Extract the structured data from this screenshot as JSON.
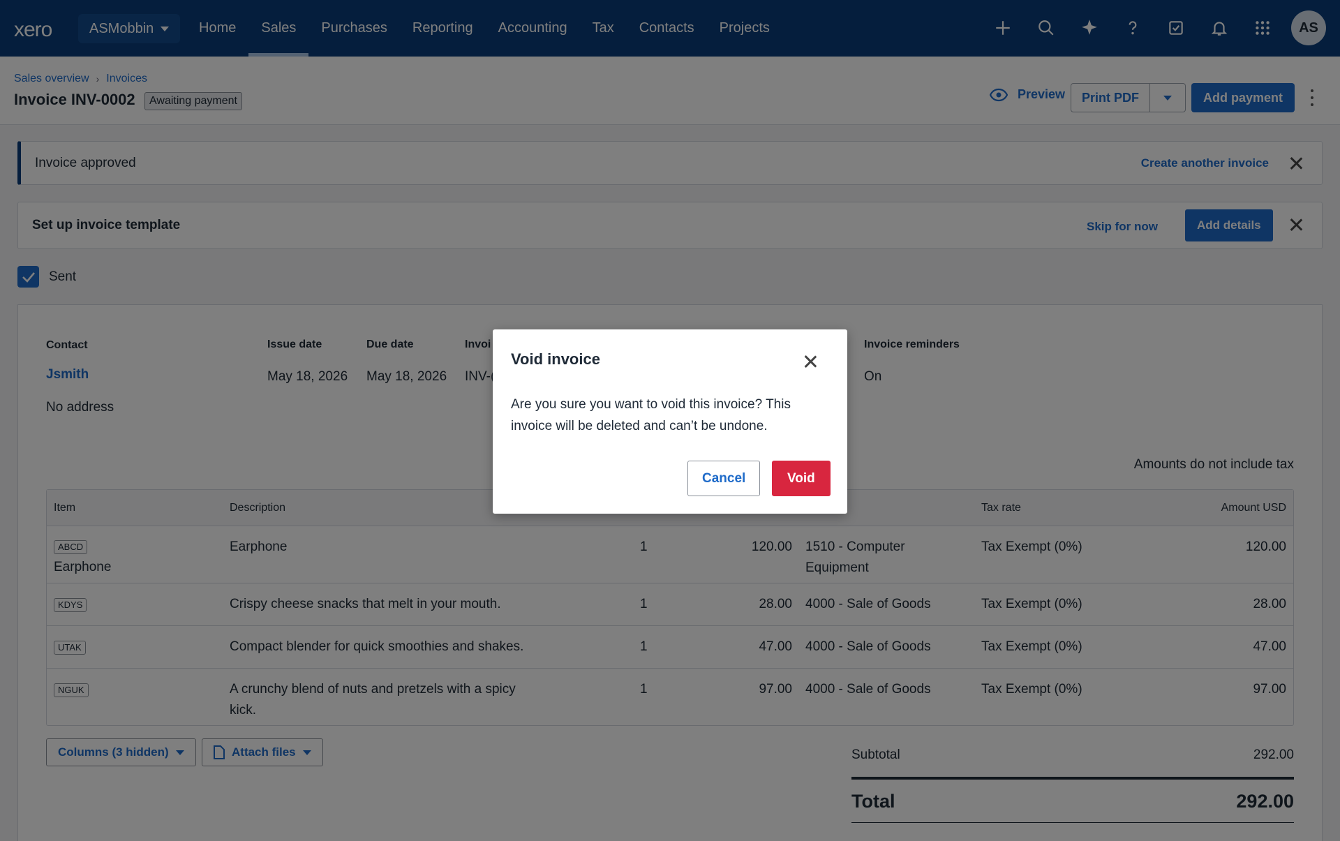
{
  "nav": {
    "logo": "xero",
    "org": "ASMobbin",
    "links": [
      "Home",
      "Sales",
      "Purchases",
      "Reporting",
      "Accounting",
      "Tax",
      "Contacts",
      "Projects"
    ],
    "active": "Sales",
    "icons": [
      "plus-icon",
      "search-icon",
      "sparkle-icon",
      "help-icon",
      "tasks-icon",
      "bell-icon",
      "apps-icon"
    ],
    "avatar": "AS"
  },
  "header": {
    "breadcrumbs": [
      "Sales overview",
      "Invoices"
    ],
    "title": "Invoice INV-0002",
    "status": "Awaiting payment",
    "preview": "Preview",
    "print_pdf": "Print PDF",
    "add_payment": "Add payment"
  },
  "banners": {
    "approved": "Invoice approved",
    "create_another": "Create another invoice",
    "template_title": "Set up invoice template",
    "skip": "Skip for now",
    "add_details": "Add details"
  },
  "sent": {
    "label": "Sent",
    "checked": true
  },
  "invoice": {
    "contact_label": "Contact",
    "contact": "Jsmith",
    "address": "No address",
    "issue_label": "Issue date",
    "issue": "May 18, 2026",
    "due_label": "Due date",
    "due": "May 18, 2026",
    "number_label": "Invoi",
    "number": "INV-(",
    "reminders_label": "Invoice reminders",
    "reminders": "On",
    "tax_note": "Amounts do not include tax",
    "columns": {
      "item": "Item",
      "description": "Description",
      "tax_rate": "Tax rate",
      "amount": "Amount USD"
    },
    "rows": [
      {
        "code": "ABCD",
        "item": "Earphone",
        "description": "Earphone",
        "qty": "1",
        "price": "120.00",
        "account_line1": "1510 - Computer",
        "account_line2": "Equipment",
        "tax": "Tax Exempt (0%)",
        "amount": "120.00"
      },
      {
        "code": "KDYS",
        "item": "",
        "description": "Crispy cheese snacks that melt in your mouth.",
        "qty": "1",
        "price": "28.00",
        "account_line1": "4000 - Sale of Goods",
        "account_line2": "",
        "tax": "Tax Exempt (0%)",
        "amount": "28.00"
      },
      {
        "code": "UTAK",
        "item": "",
        "description": "Compact blender for quick smoothies and shakes.",
        "qty": "1",
        "price": "47.00",
        "account_line1": "4000 - Sale of Goods",
        "account_line2": "",
        "tax": "Tax Exempt (0%)",
        "amount": "47.00"
      },
      {
        "code": "NGUK",
        "item": "",
        "description": "A crunchy blend of nuts and pretzels with a spicy",
        "description2": "kick.",
        "qty": "1",
        "price": "97.00",
        "account_line1": "4000 - Sale of Goods",
        "account_line2": "",
        "tax": "Tax Exempt (0%)",
        "amount": "97.00"
      }
    ],
    "columns_button": "Columns (3 hidden)",
    "attach_button": "Attach files",
    "subtotal_label": "Subtotal",
    "subtotal": "292.00",
    "total_label": "Total",
    "total": "292.00"
  },
  "modal": {
    "title": "Void invoice",
    "body": "Are you sure you want to void this invoice? This invoice will be deleted and can’t be undone.",
    "cancel": "Cancel",
    "void": "Void"
  },
  "colors": {
    "nav_bg": "#0a3d7a",
    "accent": "#1f6bc9",
    "danger": "#d8263f"
  }
}
